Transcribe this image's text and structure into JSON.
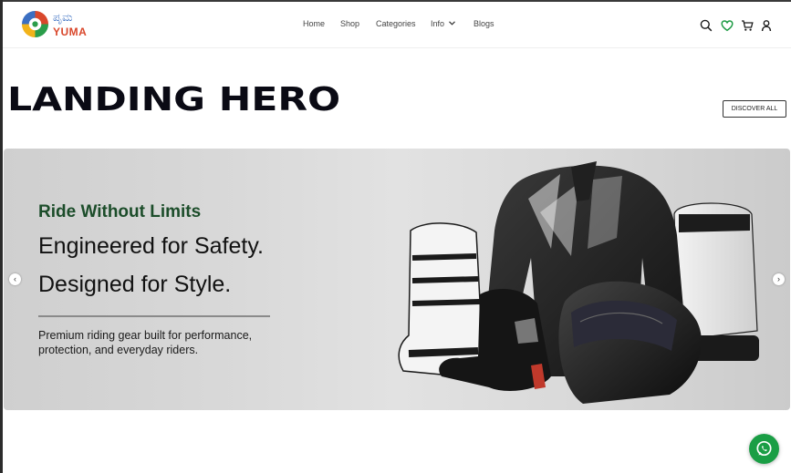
{
  "brand": {
    "script_text": "ಪೃಮ",
    "name": "YUMA",
    "colors": {
      "name": "#d9472b",
      "script": "#3b6fc2"
    }
  },
  "nav": {
    "items": [
      {
        "label": "Home"
      },
      {
        "label": "Shop"
      },
      {
        "label": "Categories"
      },
      {
        "label": "Info"
      },
      {
        "label": "Blogs"
      }
    ]
  },
  "header_icons": [
    "search-icon",
    "heart-icon",
    "cart-icon",
    "user-icon"
  ],
  "page": {
    "title": "LANDING HERO",
    "discover_label": "DISCOVER ALL"
  },
  "banner": {
    "tagline": "Ride Without Limits",
    "headline_1": "Engineered for Safety.",
    "headline_2": "Designed for Style.",
    "description": "Premium riding gear built for performance, protection, and everyday riders.",
    "prev_symbol": "‹",
    "next_symbol": "›",
    "colors": {
      "tagline": "#1c4d2a"
    }
  },
  "whatsapp": {
    "icon": "whatsapp-icon",
    "color": "#1a9e45"
  },
  "colors": {
    "wishlist_heart": "#1e9b45"
  }
}
